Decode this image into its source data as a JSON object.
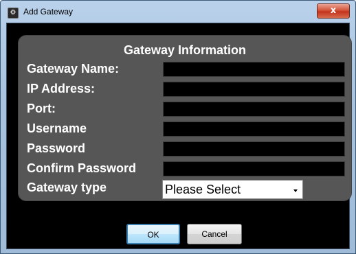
{
  "window": {
    "title": "Add Gateway",
    "close_label": "x"
  },
  "panel": {
    "title": "Gateway Information",
    "fields": [
      {
        "label": "Gateway Name:",
        "value": ""
      },
      {
        "label": "IP Address:",
        "value": ""
      },
      {
        "label": "Port:",
        "value": ""
      },
      {
        "label": "Username",
        "value": ""
      },
      {
        "label": "Password",
        "value": ""
      },
      {
        "label": "Confirm Password",
        "value": ""
      }
    ],
    "type_label": "Gateway type",
    "type_selected": "Please Select"
  },
  "buttons": {
    "ok": "OK",
    "cancel": "Cancel"
  }
}
